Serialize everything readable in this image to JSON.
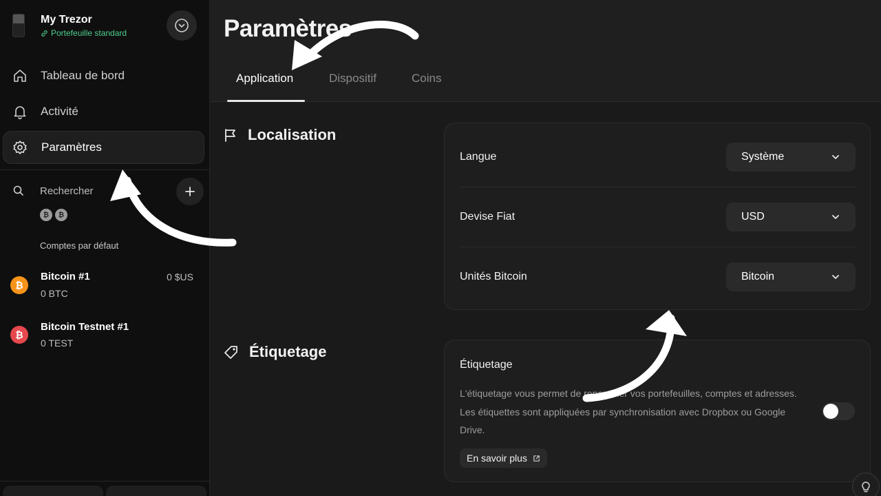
{
  "device": {
    "name": "My Trezor",
    "wallet_type": "Portefeuille standard"
  },
  "nav": [
    {
      "label": "Tableau de bord",
      "icon": "home-icon"
    },
    {
      "label": "Activité",
      "icon": "bell-icon"
    },
    {
      "label": "Paramètres",
      "icon": "gear-icon",
      "active": true
    }
  ],
  "search": {
    "label": "Rechercher"
  },
  "coin_filters": [
    "₿",
    "₿"
  ],
  "accounts_section": "Comptes par défaut",
  "accounts": [
    {
      "name": "Bitcoin #1",
      "balance": "0 BTC",
      "fiat": "0 $US",
      "color": "#f7931a"
    },
    {
      "name": "Bitcoin Testnet #1",
      "balance": "0 TEST",
      "fiat": "",
      "color": "#e5484d"
    }
  ],
  "page": {
    "title": "Paramètres",
    "tabs": [
      "Application",
      "Dispositif",
      "Coins"
    ],
    "active_tab": "Application"
  },
  "localisation": {
    "title": "Localisation",
    "rows": [
      {
        "label": "Langue",
        "value": "Système"
      },
      {
        "label": "Devise Fiat",
        "value": "USD"
      },
      {
        "label": "Unités Bitcoin",
        "value": "Bitcoin"
      }
    ]
  },
  "labeling": {
    "title": "Étiquetage",
    "card_title": "Étiquetage",
    "description": "L'étiquetage vous permet de renommer vos portefeuilles, comptes et adresses. Les étiquettes sont appliquées par synchronisation avec Dropbox ou Google Drive.",
    "toggle_on": false,
    "learn_more": "En savoir plus"
  },
  "colors": {
    "accent_green": "#4fce8e",
    "background": "#1a1a1a",
    "sidebar": "#0f0f0f"
  }
}
